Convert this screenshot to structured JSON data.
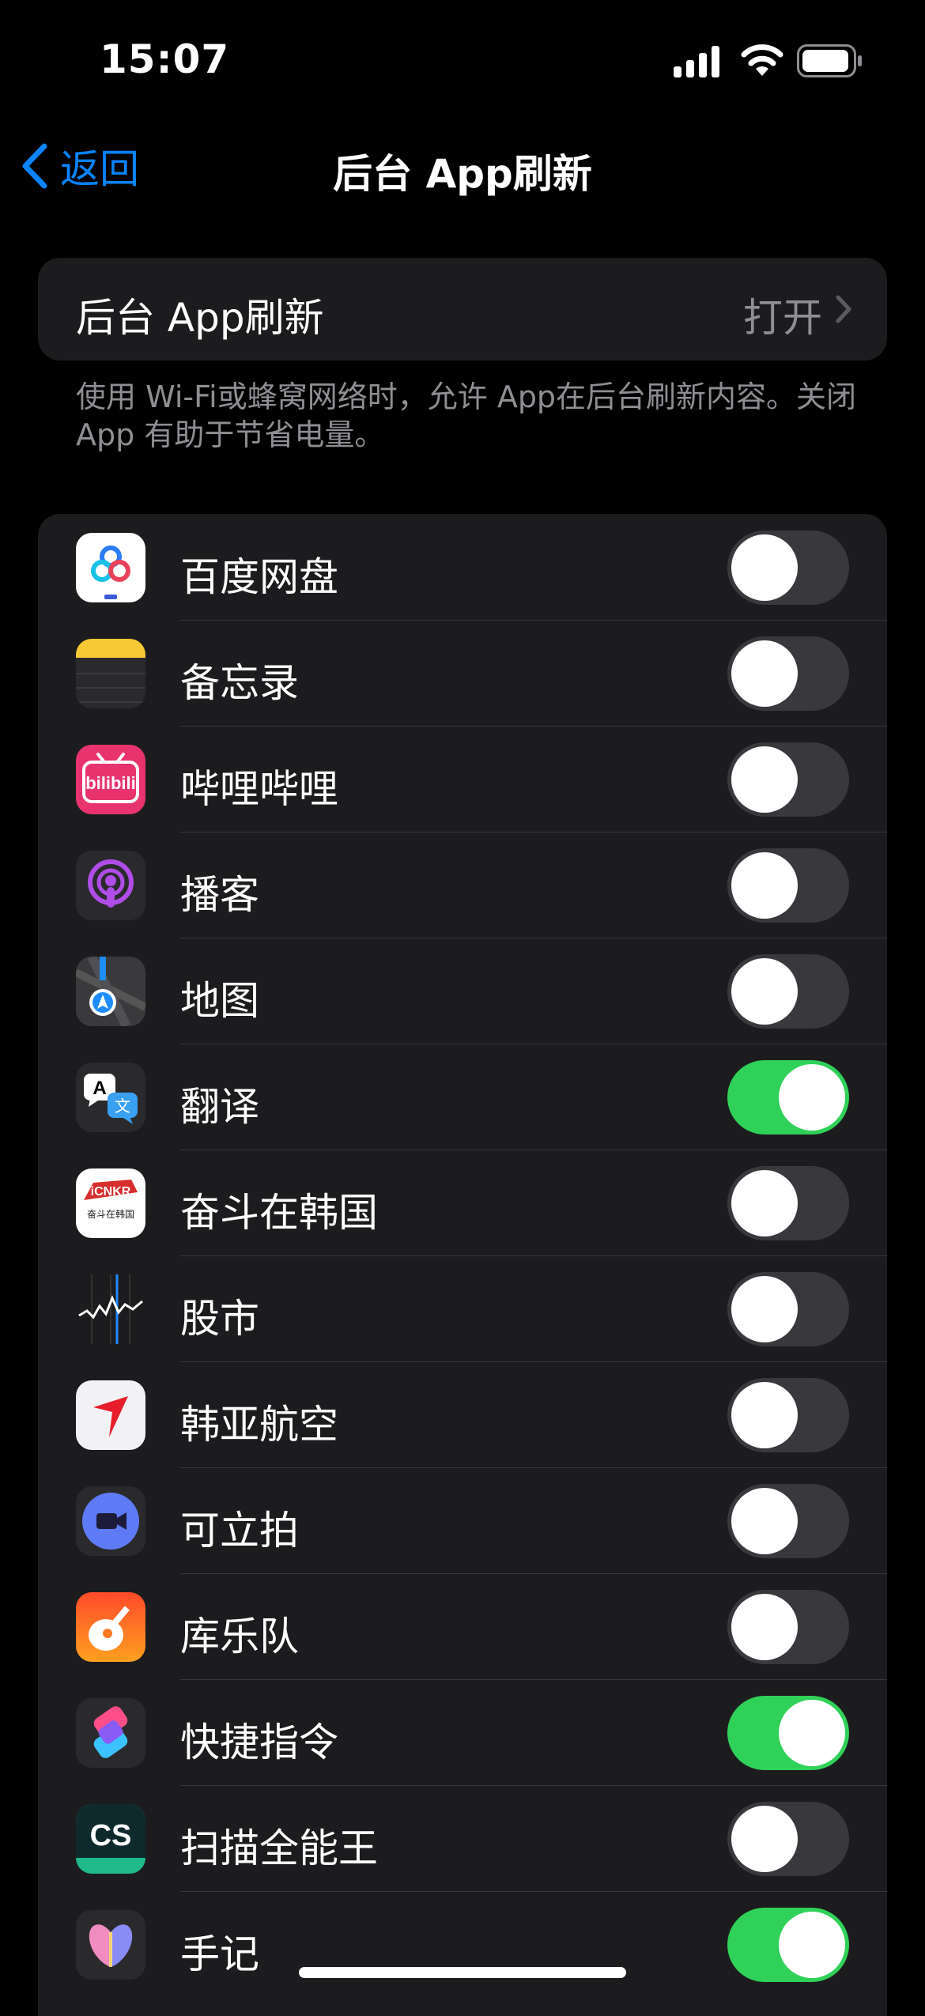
{
  "status_bar": {
    "time": "15:07",
    "icons": [
      "cellular-signal-icon",
      "wifi-icon",
      "battery-icon"
    ]
  },
  "nav": {
    "back_label": "返回",
    "title": "后台 App刷新"
  },
  "master_setting": {
    "label": "后台 App刷新",
    "value": "打开"
  },
  "footer_note": "使用 Wi-Fi或蜂窝网络时，允许 App在后台刷新内容。关闭 App 有助于节省电量。",
  "colors": {
    "accent": "#0a84ff",
    "toggle_on": "#30d158",
    "toggle_off": "#39393d",
    "group_bg": "#1c1c1e"
  },
  "apps": [
    {
      "name": "百度网盘",
      "icon": "baidu-netdisk-icon",
      "enabled": false
    },
    {
      "name": "备忘录",
      "icon": "notes-icon",
      "enabled": false
    },
    {
      "name": "哔哩哔哩",
      "icon": "bilibili-icon",
      "enabled": false
    },
    {
      "name": "播客",
      "icon": "podcasts-icon",
      "enabled": false
    },
    {
      "name": "地图",
      "icon": "maps-icon",
      "enabled": false
    },
    {
      "name": "翻译",
      "icon": "translate-icon",
      "enabled": true
    },
    {
      "name": "奋斗在韩国",
      "icon": "icnkr-icon",
      "enabled": false
    },
    {
      "name": "股市",
      "icon": "stocks-icon",
      "enabled": false
    },
    {
      "name": "韩亚航空",
      "icon": "asiana-airlines-icon",
      "enabled": false
    },
    {
      "name": "可立拍",
      "icon": "clips-icon",
      "enabled": false
    },
    {
      "name": "库乐队",
      "icon": "garageband-icon",
      "enabled": false
    },
    {
      "name": "快捷指令",
      "icon": "shortcuts-icon",
      "enabled": true
    },
    {
      "name": "扫描全能王",
      "icon": "camscanner-icon",
      "enabled": false
    },
    {
      "name": "手记",
      "icon": "journal-icon",
      "enabled": true
    }
  ]
}
